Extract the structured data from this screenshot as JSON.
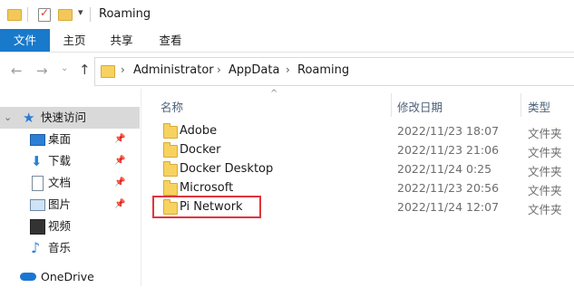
{
  "window": {
    "title": "Roaming"
  },
  "ribbon": {
    "tabs": [
      "文件",
      "主页",
      "共享",
      "查看"
    ]
  },
  "address": {
    "crumbs": [
      "Administrator",
      "AppData",
      "Roaming"
    ]
  },
  "sidebar": {
    "quick_access": "快速访问",
    "items": [
      {
        "label": "桌面",
        "icon": "desktop-icon",
        "pinned": true
      },
      {
        "label": "下载",
        "icon": "download-icon",
        "pinned": true
      },
      {
        "label": "文档",
        "icon": "document-icon",
        "pinned": true
      },
      {
        "label": "图片",
        "icon": "picture-icon",
        "pinned": true
      },
      {
        "label": "视频",
        "icon": "video-icon",
        "pinned": false
      },
      {
        "label": "音乐",
        "icon": "music-icon",
        "pinned": false
      }
    ],
    "onedrive": "OneDrive"
  },
  "columns": {
    "name": "名称",
    "date": "修改日期",
    "type": "类型"
  },
  "files": [
    {
      "name": "Adobe",
      "date": "2022/11/23 18:07",
      "type": "文件夹"
    },
    {
      "name": "Docker",
      "date": "2022/11/23 21:06",
      "type": "文件夹"
    },
    {
      "name": "Docker Desktop",
      "date": "2022/11/24 0:25",
      "type": "文件夹"
    },
    {
      "name": "Microsoft",
      "date": "2022/11/23 20:56",
      "type": "文件夹"
    },
    {
      "name": "Pi Network",
      "date": "2022/11/24 12:07",
      "type": "文件夹"
    }
  ],
  "colors": {
    "accent": "#1979ca",
    "highlight": "#e0343c",
    "folder": "#f7d260"
  }
}
